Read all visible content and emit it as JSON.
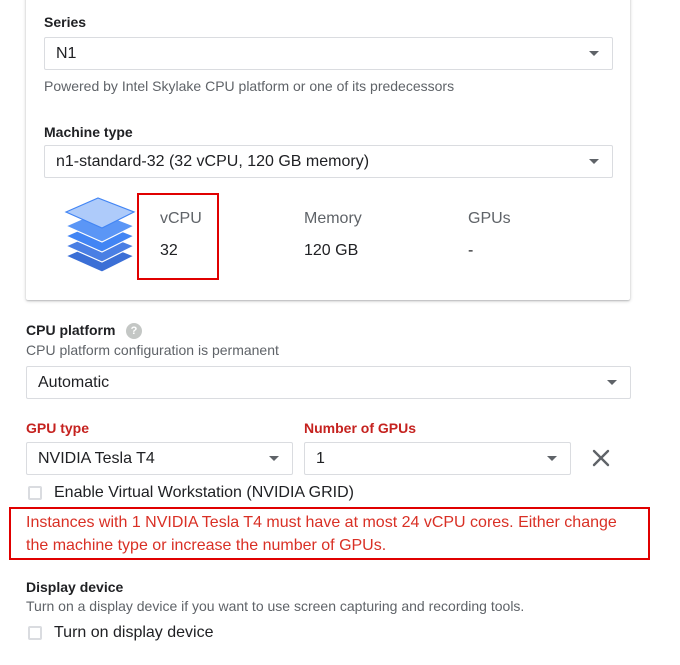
{
  "machine_config": {
    "series": {
      "label": "Series",
      "value": "N1",
      "helper": "Powered by Intel Skylake CPU platform or one of its predecessors"
    },
    "machine_type": {
      "label": "Machine type",
      "value": "n1-standard-32 (32 vCPU, 120 GB memory)"
    },
    "specs": {
      "vcpu": {
        "label": "vCPU",
        "value": "32"
      },
      "memory": {
        "label": "Memory",
        "value": "120 GB"
      },
      "gpus": {
        "label": "GPUs",
        "value": "-"
      }
    }
  },
  "cpu_platform": {
    "label": "CPU platform",
    "help_icon": "help-icon",
    "helper": "CPU platform configuration is permanent",
    "value": "Automatic"
  },
  "gpu": {
    "type_label": "GPU type",
    "type_value": "NVIDIA Tesla T4",
    "count_label": "Number of GPUs",
    "count_value": "1",
    "remove_icon": "close-icon",
    "virtual_workstation_label": "Enable Virtual Workstation (NVIDIA GRID)",
    "error_line1": "Instances with 1 NVIDIA Tesla T4 must have at most 24 vCPU cores. Either change",
    "error_line2": "the machine type or increase the number of GPUs."
  },
  "display_device": {
    "label": "Display device",
    "helper": "Turn on a display device if you want to use screen capturing and recording tools.",
    "checkbox_label": "Turn on display device"
  },
  "colors": {
    "error": "#d93025",
    "label_error": "#c5221f",
    "annotation_box": "#e00000",
    "chip_blue": "#4285f4"
  }
}
